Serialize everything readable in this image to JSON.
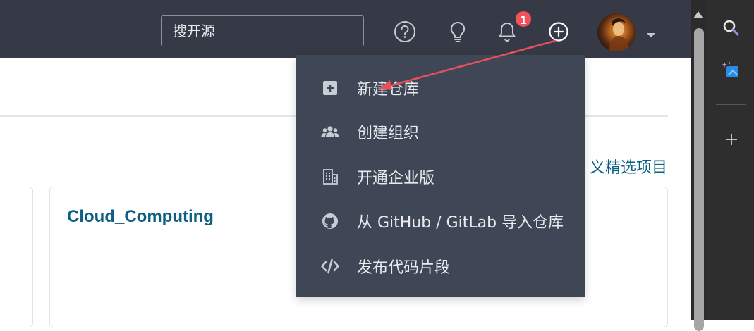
{
  "header": {
    "search": {
      "value": "",
      "placeholder": "搜开源"
    },
    "notification_count": "1",
    "icons": [
      "help-icon",
      "bulb-icon",
      "bell-icon",
      "plus-circle-icon",
      "chevron-down-icon"
    ]
  },
  "dropdown": {
    "items": [
      {
        "label": "新建仓库",
        "icon": "plus-square-icon"
      },
      {
        "label": "创建组织",
        "icon": "users-icon"
      },
      {
        "label": "开通企业版",
        "icon": "building-icon"
      },
      {
        "label": "从 GitHub / GitLab 导入仓库",
        "icon": "github-icon"
      },
      {
        "label": "发布代码片段",
        "icon": "code-icon"
      }
    ]
  },
  "content": {
    "customize_link": "义精选项目",
    "cards": [
      {
        "title": "Cloud_Computing"
      }
    ]
  },
  "side_panel": {
    "icons": [
      "search-icon",
      "copilot-icon",
      "add-icon"
    ]
  },
  "colors": {
    "topbar": "#353a46",
    "dropdown": "#3f4656",
    "link": "#0b5f82",
    "badge": "#f2525a",
    "arrow": "#e8505b"
  }
}
